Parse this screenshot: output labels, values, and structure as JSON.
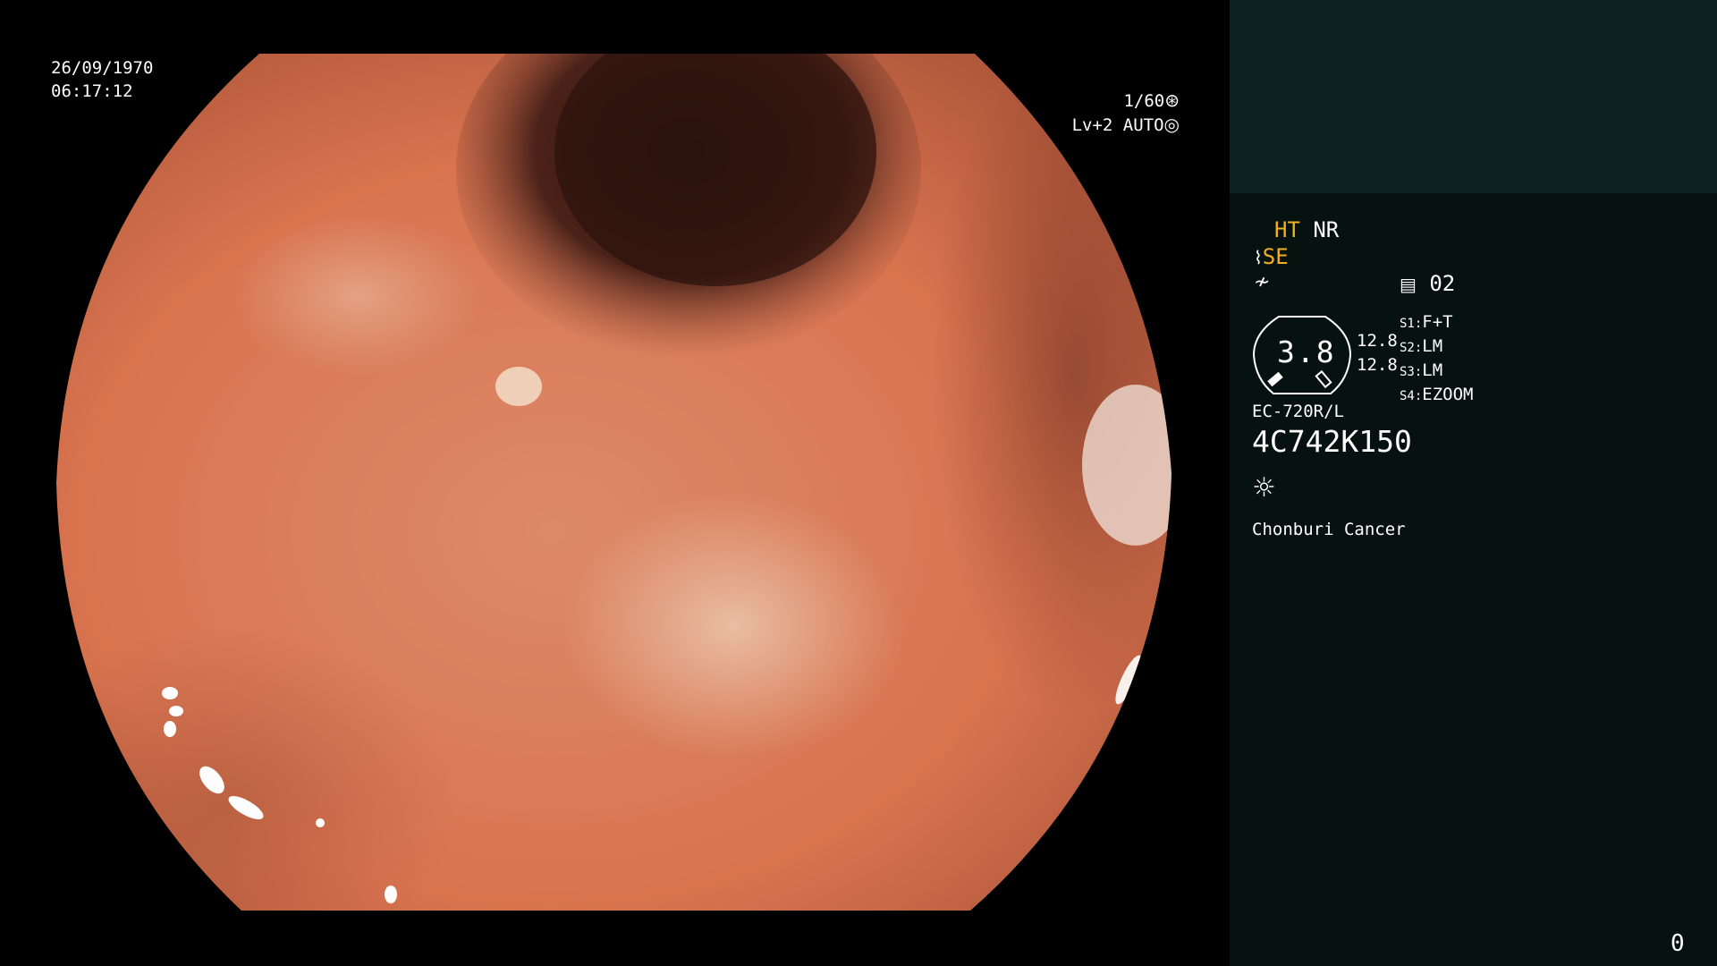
{
  "video": {
    "date": "26/09/1970",
    "time": "06:17:12",
    "shutter": "1/60",
    "shutter_icon": "iris-icon",
    "level": "Lv+2",
    "mode": "AUTO",
    "mode_icon": "auto-iris-icon",
    "colors": {
      "mucosa": "#d9744f",
      "lumen": "#3a1a14",
      "pale_patch": "#e9c3a9"
    }
  },
  "panel": {
    "ht": "HT",
    "nr": "NR",
    "se": "SE",
    "se_icon": "structure-enhance-icon",
    "fn_icon": "function-icon",
    "memo_icon": "memory-icon",
    "memo": "02",
    "gauge": {
      "value": "3.8",
      "reading_1": "12.8",
      "reading_2": "12.8"
    },
    "switches": [
      {
        "key": "S1",
        "value": "F+T"
      },
      {
        "key": "S2",
        "value": "LM"
      },
      {
        "key": "S3",
        "value": "LM"
      },
      {
        "key": "S4",
        "value": "EZOOM"
      }
    ],
    "scope_model": "EC-720R/L",
    "scope_serial": "4C742K150",
    "light_icon": "light-source-icon",
    "institution": "Chonburi Cancer",
    "counter": "0",
    "colors": {
      "accent_yellow": "#f2b01e",
      "panel_bg": "#051210",
      "panel_top_bg": "#0d2223"
    }
  }
}
